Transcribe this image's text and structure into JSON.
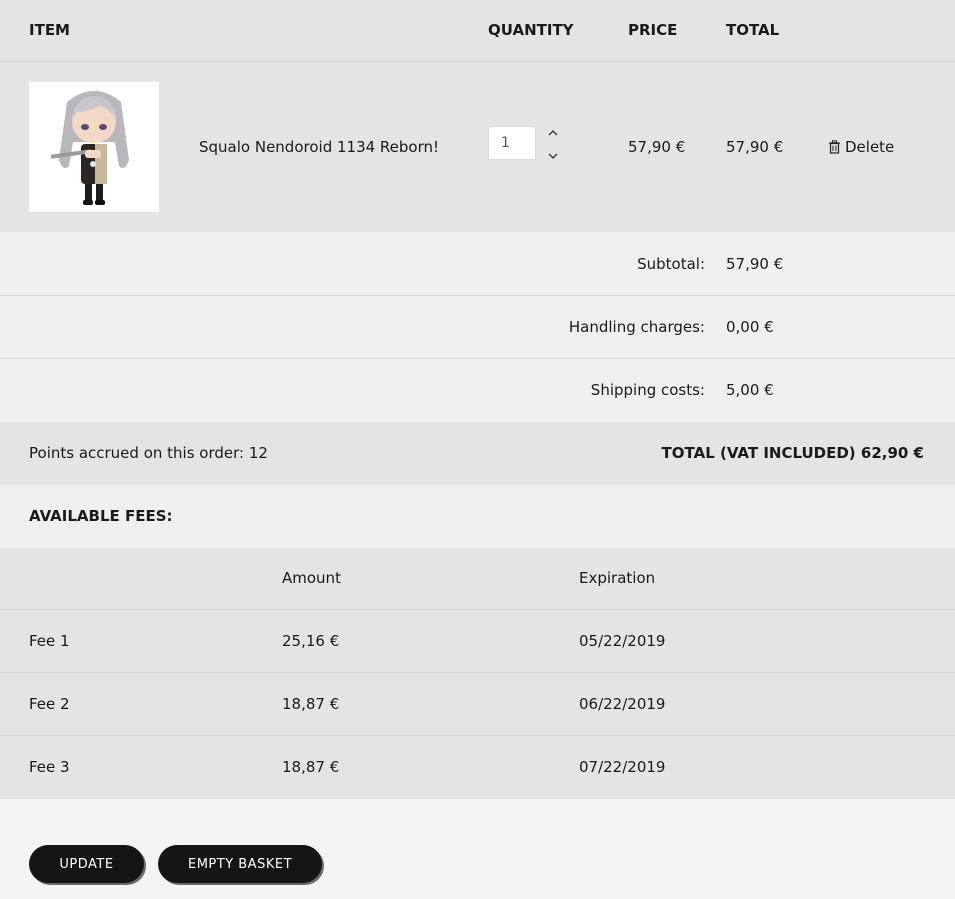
{
  "header": {
    "item": "ITEM",
    "quantity": "QUANTITY",
    "price": "PRICE",
    "total": "TOTAL"
  },
  "cart_item": {
    "name": "Squalo Nendoroid 1134 Reborn!",
    "quantity": "1",
    "price": "57,90 €",
    "total": "57,90 €",
    "delete_label": "Delete"
  },
  "summary": {
    "subtotal_label": "Subtotal:",
    "subtotal_value": "57,90 €",
    "handling_label": "Handling charges:",
    "handling_value": "0,00 €",
    "shipping_label": "Shipping costs:",
    "shipping_value": "5,00 €"
  },
  "totals": {
    "points": "Points accrued on this order: 12",
    "grand_total": "TOTAL (VAT INCLUDED) 62,90 €"
  },
  "fees": {
    "title": "AVAILABLE FEES:",
    "col_amount": "Amount",
    "col_expiration": "Expiration",
    "rows": [
      {
        "name": "Fee 1",
        "amount": "25,16 €",
        "expiration": "05/22/2019"
      },
      {
        "name": "Fee 2",
        "amount": "18,87 €",
        "expiration": "06/22/2019"
      },
      {
        "name": "Fee 3",
        "amount": "18,87 €",
        "expiration": "07/22/2019"
      }
    ]
  },
  "buttons": {
    "update": "UPDATE",
    "empty": "EMPTY BASKET"
  }
}
